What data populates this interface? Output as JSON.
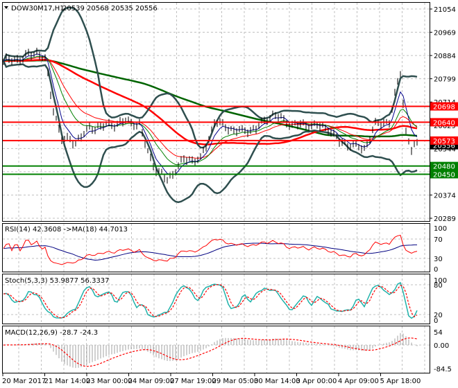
{
  "header": {
    "symbol": "DOW30M17,H1",
    "ohlc": "20539 20568 20535 20556"
  },
  "price_axis": [
    "21054",
    "20969",
    "20884",
    "20799",
    "20714",
    "20629",
    "20544",
    "20459",
    "20374",
    "20289"
  ],
  "current_price": "20556",
  "levels": [
    {
      "label": "20698",
      "price": 20698,
      "color": "#ff0000"
    },
    {
      "label": "20640",
      "price": 20640,
      "color": "#ff0000"
    },
    {
      "label": "20573",
      "price": 20573,
      "color": "#ff0000"
    },
    {
      "label": "20480",
      "price": 20480,
      "color": "#008000"
    },
    {
      "label": "20450",
      "price": 20450,
      "color": "#008000"
    }
  ],
  "time_axis": [
    "20 Mar 2017",
    "21 Mar 14:00",
    "23 Mar 00:00",
    "24 Mar 09:00",
    "27 Mar 19:00",
    "29 Mar 05:00",
    "30 Mar 14:00",
    "3 Apr 00:00",
    "4 Apr 09:00",
    "5 Apr 18:00"
  ],
  "rsi": {
    "title": "RSI(14) 42.3608  ->MA(18) 44.7013",
    "axis": [
      "100",
      "70",
      "30",
      "0"
    ]
  },
  "stoch": {
    "title": "Stoch(5,3,3) 53.9877 56.3337",
    "axis": [
      "100",
      "80",
      "20",
      "0"
    ]
  },
  "macd": {
    "title": "MACD(12,26,9) -28.7 -24.3",
    "axis": [
      "54",
      "0.00",
      "-84.5"
    ]
  },
  "colors": {
    "bars": "#000000",
    "bollinger": "#2f4f4f",
    "ema_fast": "#00008b",
    "ema_mid": "#008000",
    "ema_red": "#ff0000",
    "ma_long_red": "#ff0000",
    "ma_long_green": "#006400",
    "rsi": "#ff0000",
    "rsi_ma": "#000080",
    "stoch_main": "#20b2aa",
    "stoch_signal": "#ff0000",
    "macd_hist": "#a0a0a0",
    "macd_signal": "#ff0000"
  },
  "chart_data": {
    "type": "line",
    "title": "DOW30M17,H1",
    "ylim": [
      20289,
      21054
    ],
    "bars": 150,
    "close_knots": [
      [
        0,
        20864
      ],
      [
        6,
        20872
      ],
      [
        12,
        20897
      ],
      [
        15,
        20872
      ],
      [
        17.5,
        20707
      ],
      [
        21,
        20580
      ],
      [
        26,
        20568
      ],
      [
        31,
        20618
      ],
      [
        39,
        20631
      ],
      [
        44,
        20644
      ],
      [
        49,
        20631
      ],
      [
        52,
        20530
      ],
      [
        55,
        20466
      ],
      [
        59,
        20428
      ],
      [
        61,
        20454
      ],
      [
        65,
        20504
      ],
      [
        71,
        20504
      ],
      [
        74,
        20580
      ],
      [
        76,
        20644
      ],
      [
        81,
        20618
      ],
      [
        86,
        20606
      ],
      [
        91,
        20618
      ],
      [
        97,
        20669
      ],
      [
        104,
        20631
      ],
      [
        111,
        20631
      ],
      [
        117,
        20618
      ],
      [
        121,
        20568
      ],
      [
        126,
        20555
      ],
      [
        130,
        20542
      ],
      [
        134,
        20631
      ],
      [
        139,
        20644
      ],
      [
        142,
        20783
      ],
      [
        143,
        20821
      ],
      [
        145,
        20606
      ],
      [
        147,
        20542
      ],
      [
        149,
        20556
      ]
    ],
    "indicators": {
      "bollinger": [
        20,
        2
      ],
      "ema": [
        5,
        13,
        21
      ],
      "ma_long": [
        50,
        100
      ],
      "rsi": 14,
      "rsi_ma": 18,
      "stoch": [
        5,
        3,
        3
      ],
      "macd": [
        12,
        26,
        9
      ]
    }
  }
}
